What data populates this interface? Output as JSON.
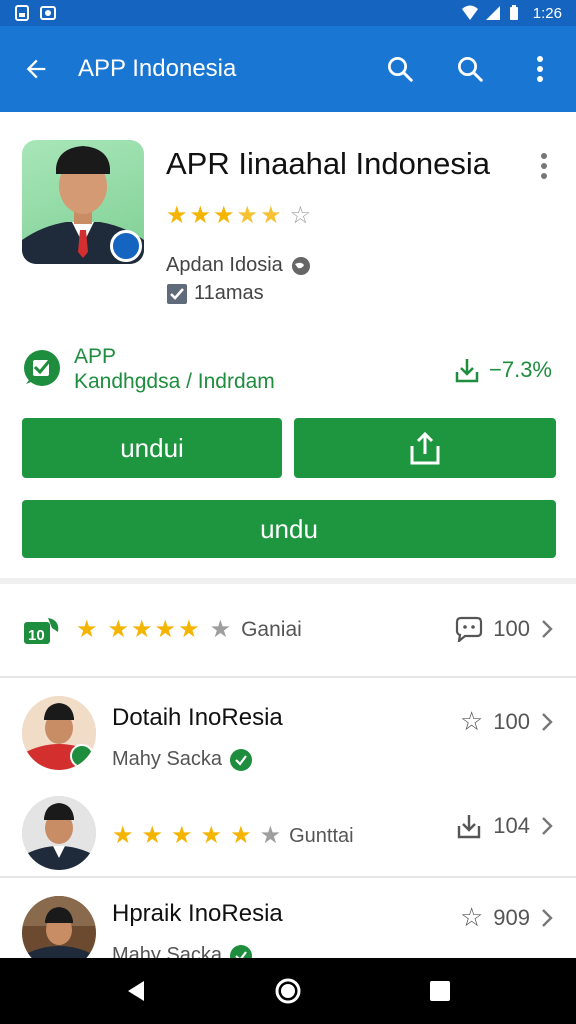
{
  "status_bar": {
    "time": "1:26"
  },
  "app_bar": {
    "title": "APP Indonesia",
    "back_icon": "arrow-back-icon",
    "actions": [
      "search-icon",
      "search-icon",
      "more-vert-icon"
    ]
  },
  "app": {
    "title": "APR Iinaahal Indonesia",
    "rating": 3.5,
    "developer": "Apdan Idosia",
    "sub": "11amas"
  },
  "info": {
    "line1": "APP",
    "line2": "Kandhgdsa / Indrdam",
    "stat": "−7.3%"
  },
  "buttons": {
    "install": "undui",
    "wide": "undu"
  },
  "summary": {
    "rating": 4,
    "label": "Ganiai",
    "count": "100"
  },
  "list": [
    {
      "title": "Dotaih InoResia",
      "sub": "Mahy Sacka",
      "count": "100",
      "meta_icon": "star-outline-icon"
    },
    {
      "title": "",
      "sub": "Gunttai",
      "rating": 4,
      "count": "104",
      "meta_icon": "download-icon"
    },
    {
      "title": "Hpraik InoResia",
      "sub": "Mahy Sacka",
      "count": "909",
      "meta_icon": "star-outline-icon"
    }
  ],
  "colors": {
    "status_bar": "#1565c0",
    "app_bar": "#1976d2",
    "green": "#1e9640",
    "star": "#f4b400"
  }
}
